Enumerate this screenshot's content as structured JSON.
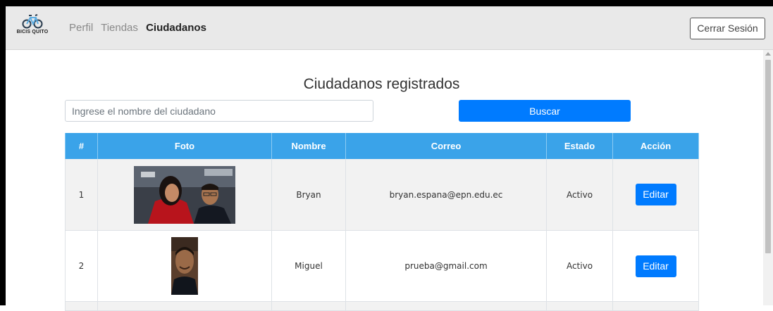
{
  "navbar": {
    "logo_text": "BICIS QUITO",
    "links": [
      "Perfil",
      "Tiendas",
      "Ciudadanos"
    ],
    "active_link": "Ciudadanos",
    "logout_label": "Cerrar Sesión"
  },
  "page": {
    "title": "Ciudadanos registrados"
  },
  "search": {
    "placeholder": "Ingrese el nombre del ciudadano",
    "value": "",
    "button_label": "Buscar"
  },
  "table": {
    "headers": [
      "#",
      "Foto",
      "Nombre",
      "Correo",
      "Estado",
      "Acción"
    ],
    "rows": [
      {
        "num": "1",
        "photo": "couple-photo",
        "name": "Bryan",
        "email": "bryan.espana@epn.edu.ec",
        "status": "Activo",
        "action": "Editar"
      },
      {
        "num": "2",
        "photo": "portrait-photo",
        "name": "Miguel",
        "email": "prueba@gmail.com",
        "status": "Activo",
        "action": "Editar"
      }
    ]
  },
  "colors": {
    "primary": "#007bff",
    "table_header": "#3aa3e9",
    "navbar_bg": "#e9e9e9"
  }
}
